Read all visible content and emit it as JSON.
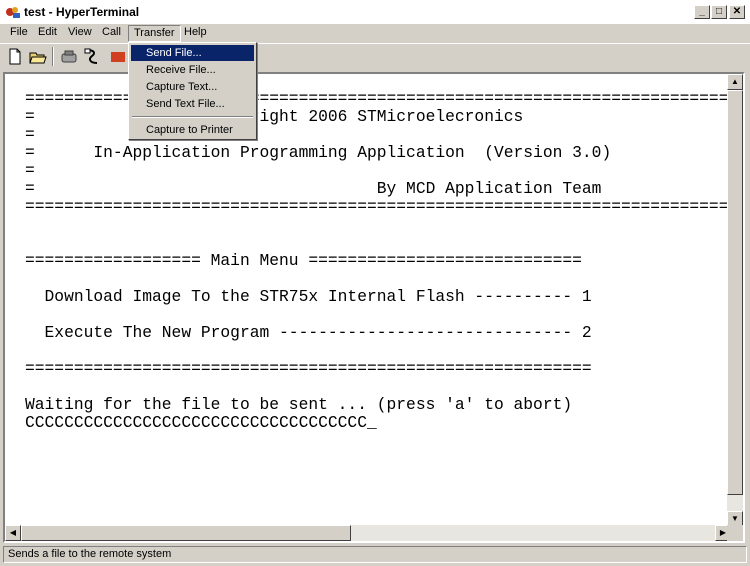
{
  "window": {
    "title": "test - HyperTerminal",
    "icon": "hyperterminal-icon",
    "controls": {
      "minimize": "_",
      "maximize": "□",
      "close": "✕"
    }
  },
  "menubar": {
    "items": [
      {
        "label": "File"
      },
      {
        "label": "Edit"
      },
      {
        "label": "View"
      },
      {
        "label": "Call"
      },
      {
        "label": "Transfer"
      },
      {
        "label": "Help"
      }
    ],
    "active": "Transfer"
  },
  "toolbar": {
    "tools": [
      "new-icon",
      "open-icon",
      "disconnect-icon",
      "dial-icon",
      "properties-icon"
    ]
  },
  "transfer_menu": {
    "items": [
      {
        "label": "Send File..."
      },
      {
        "label": "Receive File..."
      },
      {
        "label": "Capture Text..."
      },
      {
        "label": "Send Text File..."
      },
      {
        "label": "Capture to Printer"
      }
    ],
    "highlighted": "Send File..."
  },
  "terminal": {
    "lines": [
      "============================================================================",
      "=              (C) Copyright 2006 STMicroelecronics                        =",
      "=                                                                          =",
      "=      In-Application Programming Application  (Version 3.0)               =",
      "=                                                                          =",
      "=                                   By MCD Application Team                =",
      "============================================================================",
      "",
      "",
      "================== Main Menu ============================",
      "",
      "  Download Image To the STR75x Internal Flash ---------- 1",
      "",
      "  Execute The New Program ------------------------------ 2",
      "",
      "==========================================================",
      "",
      "Waiting for the file to be sent ... (press 'a' to abort)",
      "CCCCCCCCCCCCCCCCCCCCCCCCCCCCCCCCCCC_"
    ]
  },
  "statusbar": {
    "text": "Sends a file to the remote system"
  }
}
